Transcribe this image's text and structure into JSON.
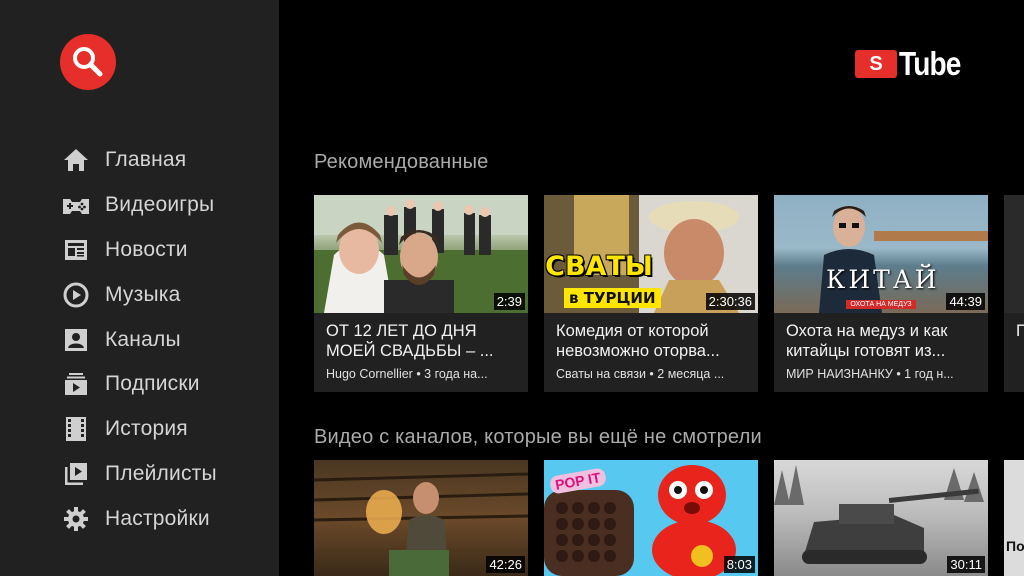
{
  "app": {
    "logo_letter": "S",
    "logo_text": "Tube"
  },
  "colors": {
    "accent": "#e62e2a",
    "sidebar_bg": "#212121",
    "background": "#000000"
  },
  "sidebar": {
    "search_icon": "search-icon",
    "items": [
      {
        "label": "Главная",
        "icon": "home-icon"
      },
      {
        "label": "Видеоигры",
        "icon": "gamepad-icon"
      },
      {
        "label": "Новости",
        "icon": "newspaper-icon"
      },
      {
        "label": "Музыка",
        "icon": "music-icon"
      },
      {
        "label": "Каналы",
        "icon": "channel-icon"
      },
      {
        "label": "Подписки",
        "icon": "subscriptions-icon"
      },
      {
        "label": "История",
        "icon": "history-icon"
      },
      {
        "label": "Плейлисты",
        "icon": "playlist-icon"
      },
      {
        "label": "Настройки",
        "icon": "settings-icon"
      }
    ]
  },
  "sections": [
    {
      "title": "Рекомендованные",
      "videos": [
        {
          "title": "ОТ 12 ЛЕТ ДО ДНЯ МОЕЙ СВАДЬБЫ – ...",
          "channel": "Hugo Cornellier • 3 года на...",
          "duration": "2:39"
        },
        {
          "title": "Комедия от которой невозможно оторва...",
          "channel": "Сваты на связи • 2 месяца ...",
          "duration": "2:30:36",
          "overlay_line1": "СВАТЫ",
          "overlay_line2": "в ТУРЦИИ"
        },
        {
          "title": "Охота на медуз и как китайцы готовят из...",
          "channel": "МИР НАИЗНАНКУ • 1 год н...",
          "duration": "44:39",
          "overlay_line1": "КИТАЙ",
          "overlay_line2": "ОХОТА НА МЕДУЗ"
        },
        {
          "title": "П... С...",
          "channel": "",
          "duration": ""
        }
      ]
    },
    {
      "title": "Видео с каналов, которые вы ещё не смотрели",
      "videos": [
        {
          "title": "",
          "channel": "",
          "duration": "42:26"
        },
        {
          "title": "",
          "channel": "",
          "duration": "8:03",
          "overlay_line1": "POP IT"
        },
        {
          "title": "",
          "channel": "",
          "duration": "30:11"
        },
        {
          "title": "",
          "channel": "",
          "duration": "",
          "overlay_line1": "По"
        }
      ]
    }
  ]
}
